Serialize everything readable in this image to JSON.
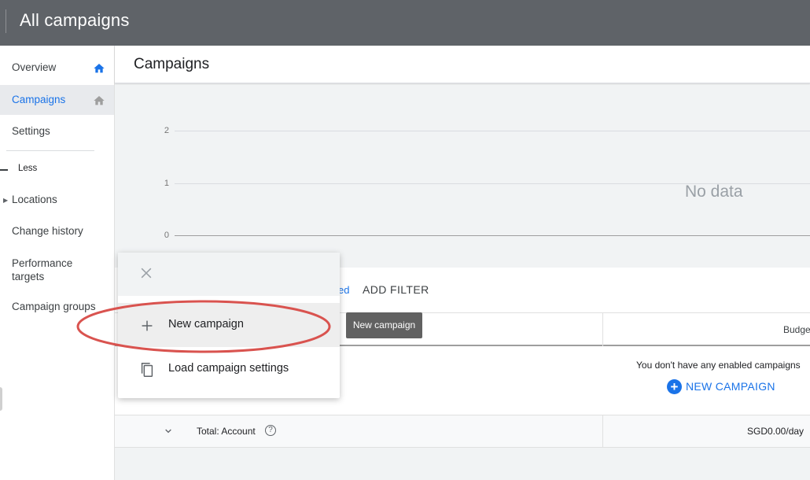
{
  "topbar": {
    "title": "All campaigns"
  },
  "sidebar": {
    "items": [
      {
        "label": "Overview",
        "icon": "home-icon"
      },
      {
        "label": "Campaigns",
        "icon": "home-icon",
        "active": true
      },
      {
        "label": "Settings"
      },
      {
        "label": "Locations"
      },
      {
        "label": "Change history"
      },
      {
        "label": "Performance targets"
      },
      {
        "label": "Campaign groups"
      }
    ],
    "less_label": "Less"
  },
  "header": {
    "page_title": "Campaigns"
  },
  "chart": {
    "y_ticks": [
      "2",
      "1",
      "0"
    ],
    "no_data": "No data"
  },
  "table": {
    "filter_partial": "ed",
    "add_filter": "ADD FILTER",
    "budget_header": "Budge",
    "empty_message": "You don't have any enabled campaigns",
    "new_campaign_link": "NEW CAMPAIGN",
    "total_label": "Total: Account",
    "total_budget": "SGD0.00/day"
  },
  "popup": {
    "items": [
      {
        "label": "New campaign",
        "icon": "plus-icon"
      },
      {
        "label": "Load campaign settings",
        "icon": "copy-icon"
      }
    ]
  },
  "tooltip": {
    "text": "New campaign"
  },
  "colors": {
    "topbar": "#5f6368",
    "accent": "#1a73e8",
    "annotation": "#d9534f"
  }
}
